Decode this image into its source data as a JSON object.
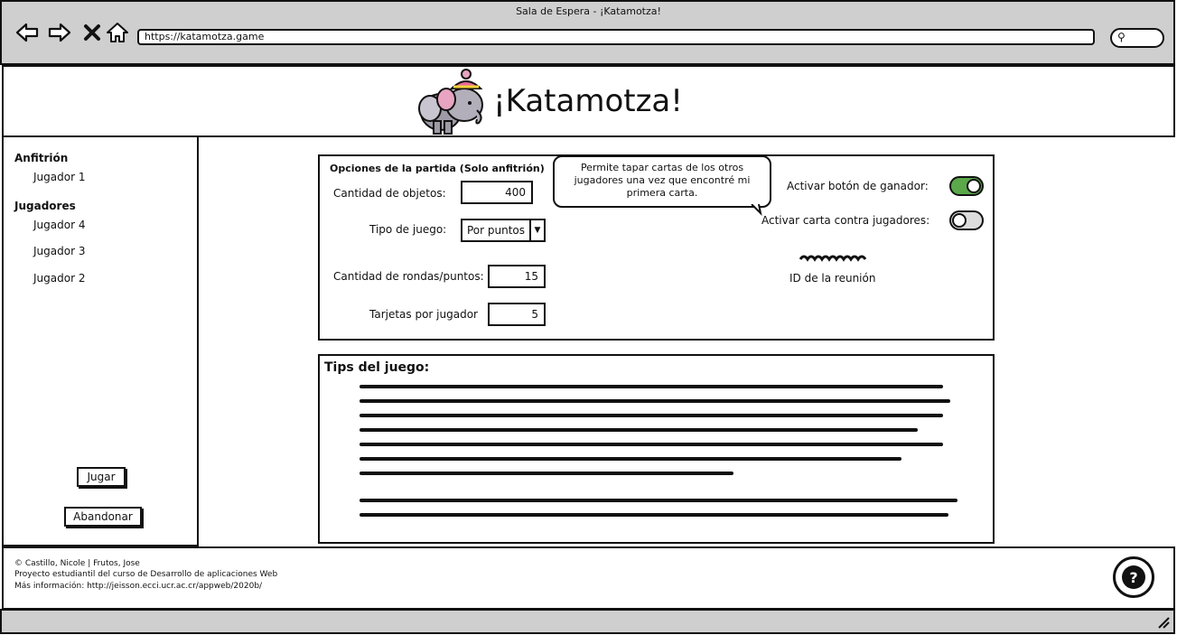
{
  "window": {
    "title": "Sala de Espera - ¡Katamotza!"
  },
  "browser": {
    "url": "https://katamotza.game",
    "back_icon": "arrow-left-icon",
    "forward_icon": "arrow-right-icon",
    "stop_icon": "close-icon",
    "home_icon": "home-icon",
    "search_icon": "search-icon"
  },
  "header": {
    "title": "¡Katamotza!",
    "logo": "elephant-logo"
  },
  "sidebar": {
    "host_heading": "Anfitrión",
    "host_player": "Jugador 1",
    "players_heading": "Jugadores",
    "players": [
      "Jugador 4",
      "Jugador 3",
      "Jugador 2"
    ],
    "play_button": "Jugar",
    "leave_button": "Abandonar"
  },
  "options": {
    "title": "Opciones de la partida (Solo anfitrión)",
    "objects_label": "Cantidad de objetos:",
    "objects_value": "400",
    "game_type_label": "Tipo de juego:",
    "game_type_value": "Por puntos",
    "rounds_label": "Cantidad de rondas/puntos:",
    "rounds_value": "15",
    "cards_label": "Tarjetas por jugador",
    "cards_value": "5",
    "tooltip": "Permite tapar cartas de los otros jugadores una vez que encontré mi primera carta.",
    "winner_button_label": "Activar botón de ganador:",
    "winner_button_on": true,
    "card_vs_players_label": "Activar carta contra jugadores:",
    "card_vs_players_on": false,
    "meeting_id_label": "ID de la reunión",
    "toggle_on_color": "#5aa84a"
  },
  "tips": {
    "title": "Tips del juego:"
  },
  "footer": {
    "line1": "© Castillo, Nicole | Frutos, Jose",
    "line2": "Proyecto estudiantil del curso de Desarrollo de aplicaciones Web",
    "line3": "Más información: http://jeisson.ecci.ucr.ac.cr/appweb/2020b/",
    "help_icon": "help-icon"
  }
}
